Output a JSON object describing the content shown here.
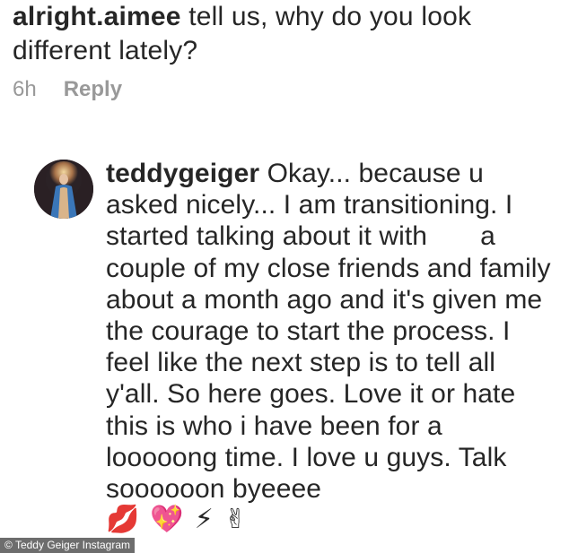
{
  "top_comment": {
    "username": "alright.aimee",
    "text": " tell us, why do you look different lately?",
    "time": "6h",
    "reply_label": "Reply"
  },
  "reply": {
    "username": "teddygeiger",
    "text": " Okay... because u asked nicely... I am transitioning. I started talking about it with       a couple of my close friends and family about a month ago and it's given me the courage to start the process. I feel like the next step is to tell all y'all. So here goes. Love it or hate this is who i have been for a looooong time. I love u guys. Talk soooooon byeeee",
    "emojis": [
      "💋",
      "💖",
      "⚡",
      "✌"
    ]
  },
  "credit": "© Teddy Geiger Instagram",
  "colors": {
    "text": "#262626",
    "muted": "#999999",
    "credit_bg": "#3c3c3c"
  }
}
